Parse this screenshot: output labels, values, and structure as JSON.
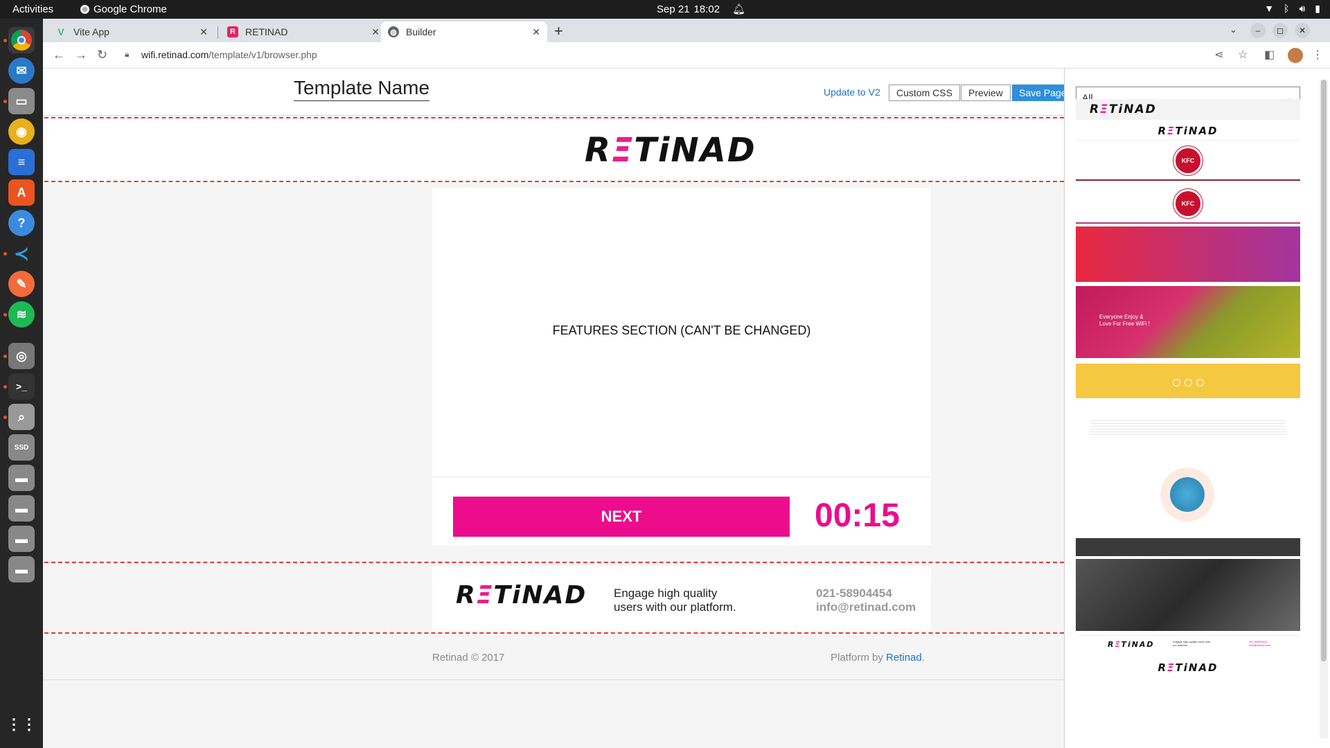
{
  "os": {
    "activities": "Activities",
    "app_name": "Google Chrome",
    "date": "Sep 21",
    "time": "18:02"
  },
  "tabs": [
    {
      "title": "Vite App",
      "close": "✕"
    },
    {
      "title": "RETINAD",
      "close": "✕"
    },
    {
      "title": "Builder",
      "close": "✕"
    }
  ],
  "url": {
    "domain": "wifi.retinad.com",
    "path": "/template/v1/browser.php"
  },
  "builder": {
    "template_name": "Template Name",
    "update_link": "Update to V2",
    "custom_css": "Custom CSS",
    "preview": "Preview",
    "save": "Save Page"
  },
  "template": {
    "logo": {
      "r": "R",
      "e": "Ξ",
      "rest": "TiNAD"
    },
    "features_text": "FEATURES SECTION (CAN'T BE CHANGED)",
    "next_label": "NEXT",
    "timer": "00:15",
    "footer_tagline_1": "Engage high quality",
    "footer_tagline_2": "users with our platform.",
    "phone": "021-58904454",
    "email": "info@retinad.com",
    "copyright": "Retinad © 2017",
    "platform_prefix": "Platform by ",
    "platform_link": "Retinad",
    "platform_suffix": "."
  },
  "panel": {
    "category": "All",
    "thumb_text_1": "Everyone Enjoy &",
    "thumb_text_2": "Love For Free WiFi !",
    "thumb_kfc": "KFC",
    "thumb_footer_tag": "Engage high quality users with our platform."
  },
  "colors": {
    "brand_pink": "#ec0c8c",
    "save_blue": "#2f8fdc",
    "link_blue": "#1e73be"
  }
}
